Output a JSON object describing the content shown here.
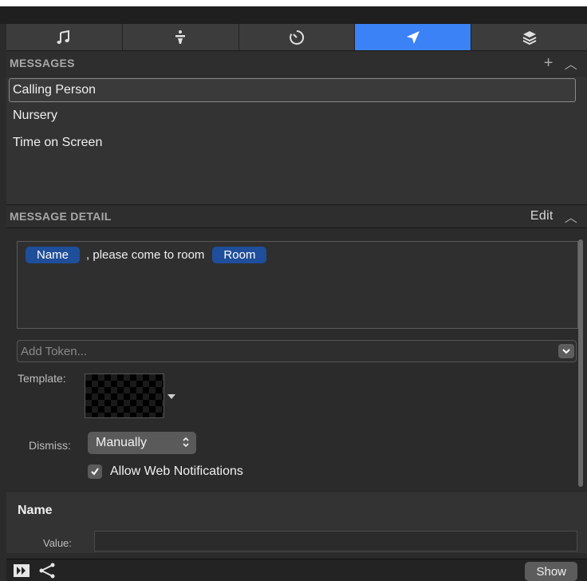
{
  "tabs": [
    {
      "icon": "music-note-icon",
      "active": false
    },
    {
      "icon": "stage-icon",
      "active": false
    },
    {
      "icon": "timer-icon",
      "active": false
    },
    {
      "icon": "messages-send-icon",
      "active": true
    },
    {
      "icon": "layers-icon",
      "active": false
    }
  ],
  "messages": {
    "header": "MESSAGES",
    "add_glyph": "+",
    "collapse_glyph": "︿",
    "items": [
      {
        "label": "Calling Person",
        "selected": true
      },
      {
        "label": "Nursery",
        "selected": false
      },
      {
        "label": "Time on Screen",
        "selected": false
      }
    ]
  },
  "detail": {
    "header": "MESSAGE DETAIL",
    "edit_label": "Edit",
    "collapse_glyph": "︿",
    "token1": "Name",
    "text_middle": ", please come to room",
    "token2": "Room",
    "add_token_placeholder": "Add Token...",
    "template_label": "Template:",
    "dismiss_label": "Dismiss:",
    "dismiss_value": "Manually",
    "allow_web_label": "Allow Web Notifications",
    "allow_web_checked": true
  },
  "name_section": {
    "title": "Name",
    "value_label": "Value:",
    "value": ""
  },
  "bottom": {
    "show_label": "Show"
  },
  "colors": {
    "accent": "#3b82f6",
    "token": "#1f4e9a"
  }
}
